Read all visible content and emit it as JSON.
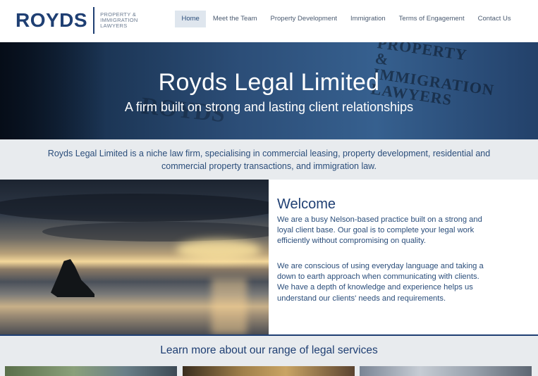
{
  "header": {
    "logo_word": "ROYDS",
    "logo_tag_lines": [
      "PROPERTY &",
      "IMMIGRATION",
      "LAWYERS"
    ],
    "nav": [
      {
        "label": "Home",
        "active": true
      },
      {
        "label": "Meet the Team",
        "active": false
      },
      {
        "label": "Property Development",
        "active": false
      },
      {
        "label": "Immigration",
        "active": false
      },
      {
        "label": "Terms of Engagement",
        "active": false
      },
      {
        "label": "Contact Us",
        "active": false
      }
    ]
  },
  "hero": {
    "title": "Royds Legal Limited",
    "subtitle": "A firm built on strong and lasting client relationships",
    "sign_text_lines": [
      "PROPERTY &",
      "IMMIGRATION",
      "LAWYERS"
    ],
    "sign_word": "ROYDS"
  },
  "intro": {
    "text": "Royds Legal Limited is a niche law firm, specialising in commercial leasing, property development, residential and commercial property transactions, and immigration law."
  },
  "welcome": {
    "heading": "Welcome",
    "paragraph1": "We are a busy Nelson-based practice built on a strong and loyal client base.  Our goal is to complete your legal work efficiently without compromising on quality.",
    "paragraph2": "We are conscious of using everyday language and taking a down to earth approach when communicating with clients.  We have a depth of knowledge and experience  helps us understand our clients' needs and requirements."
  },
  "services": {
    "heading": "Learn more about our range of legal services"
  },
  "colors": {
    "brand_navy": "#1f3f73",
    "text_blue": "#2a4d7a",
    "band_grey": "#e8ebee",
    "nav_active_bg": "#dfe6ee"
  }
}
